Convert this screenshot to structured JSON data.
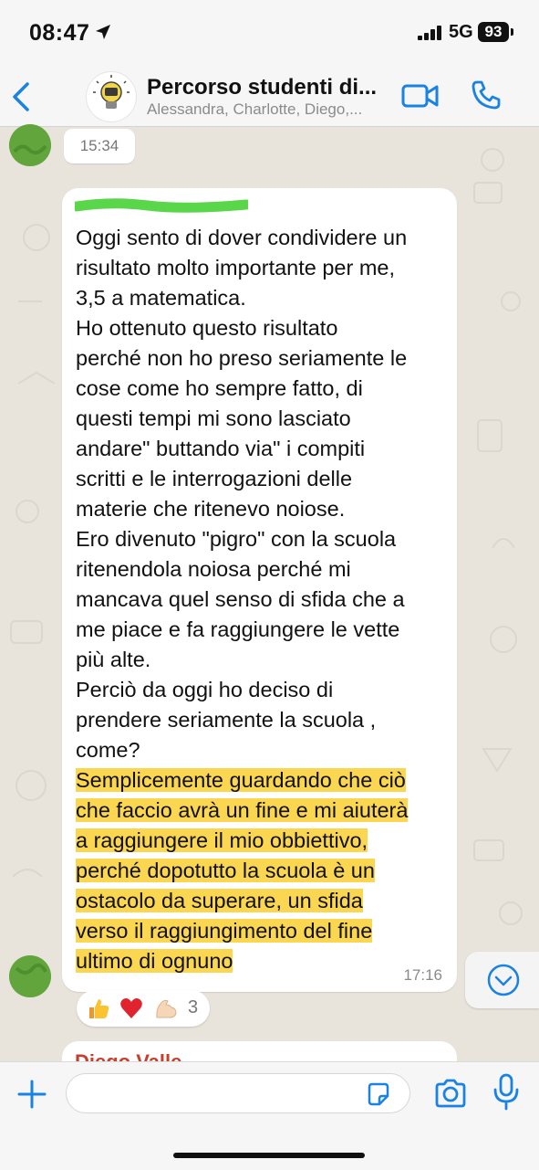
{
  "status_bar": {
    "time": "08:47",
    "network": "5G",
    "battery": "93"
  },
  "header": {
    "title": "Percorso studenti di...",
    "subtitle": "Alessandra, Charlotte, Diego,..."
  },
  "chat": {
    "time_pill": "15:34",
    "message": {
      "text_plain": "Oggi sento di dover condividere un\nrisultato molto importante per me,\n3,5 a matematica.\nHo ottenuto questo risultato\nperché non ho preso seriamente le\ncose come ho sempre fatto, di\nquesti tempi mi sono lasciato\nandare\" buttando via\" i compiti\nscritti e le interrogazioni delle\nmaterie che ritenevo noiose.\nEro divenuto \"pigro\" con la scuola\nritenendola noiosa perché mi\nmancava quel senso di sfida che a\nme piace e fa raggiungere le vette\npiù alte.\nPerciò da oggi ho deciso di\nprendere seriamente la scuola ,\ncome?\n",
      "text_highlighted": "Semplicemente guardando che ciò\nche faccio avrà un fine e mi aiuterà\na raggiungere il mio obbiettivo,\nperché dopotutto la scuola è un\nostacolo da superare, un sfida\nverso il raggiungimento del fine\nultimo di ognuno",
      "time": "17:16"
    },
    "reactions": {
      "emojis": [
        "👍",
        "❤️",
        "💪"
      ],
      "count": "3"
    },
    "next_sender": "Diego Valle"
  },
  "composer": {
    "placeholder": ""
  },
  "colors": {
    "accent": "#1a82e2",
    "highlight": "#fbd651",
    "avatar_green": "#61a53c",
    "sender_red": "#c83e2d"
  },
  "icons": [
    "location-arrow-icon",
    "signal-icon",
    "back-chevron-icon",
    "video-call-icon",
    "phone-icon",
    "chevron-down-icon",
    "plus-icon",
    "sticker-icon",
    "camera-icon",
    "microphone-icon"
  ]
}
